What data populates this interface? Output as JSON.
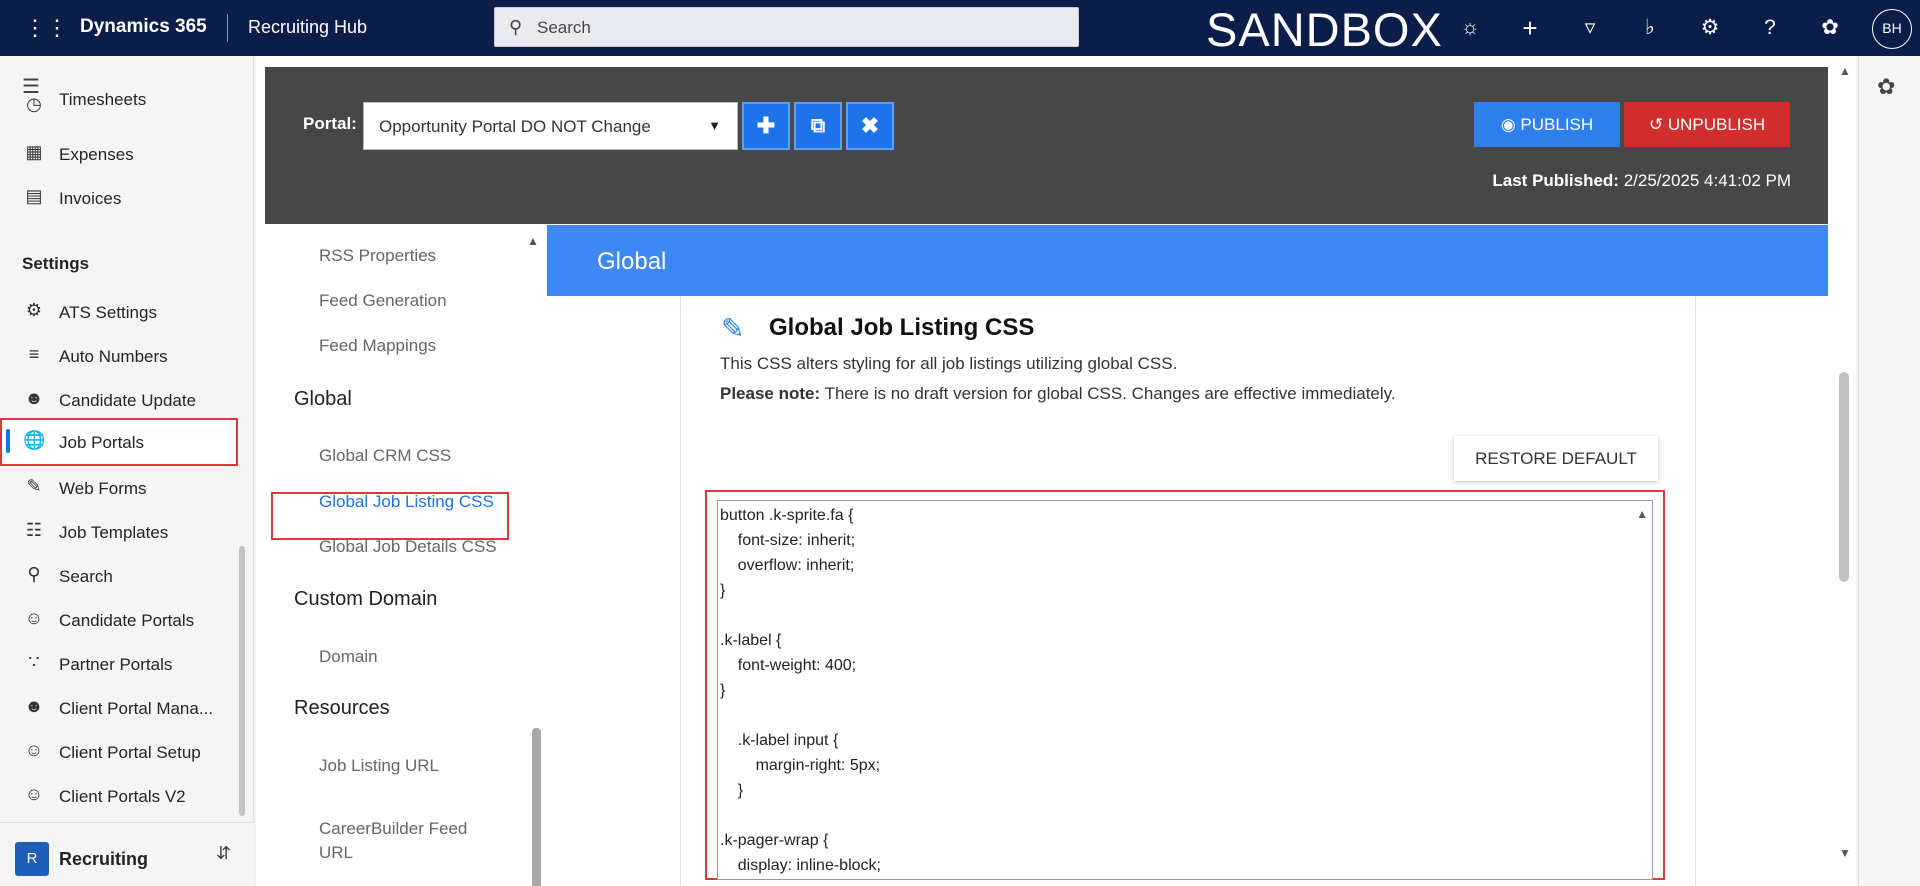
{
  "topbar": {
    "app_name": "Dynamics 365",
    "area_name": "Recruiting Hub",
    "search_placeholder": "Search",
    "env_label": "SANDBOX",
    "avatar_initials": "BH",
    "icons": [
      "lightbulb-icon",
      "plus-icon",
      "filter-icon",
      "bell-icon",
      "gear-icon",
      "help-icon",
      "copilot-icon"
    ]
  },
  "leftnav": {
    "items_top": [
      {
        "label": "Timesheets",
        "icon": "timesheet-icon"
      },
      {
        "label": "Expenses",
        "icon": "expenses-icon"
      },
      {
        "label": "Invoices",
        "icon": "invoice-icon"
      }
    ],
    "settings_heading": "Settings",
    "settings_items": [
      {
        "label": "ATS Settings",
        "icon": "gear-icon"
      },
      {
        "label": "Auto Numbers",
        "icon": "numbered-list-icon"
      },
      {
        "label": "Candidate Update",
        "icon": "person-sync-icon"
      },
      {
        "label": "Job Portals",
        "icon": "globe-icon",
        "active": true
      },
      {
        "label": "Web Forms",
        "icon": "form-edit-icon"
      },
      {
        "label": "Job Templates",
        "icon": "template-icon"
      },
      {
        "label": "Search",
        "icon": "search-people-icon"
      },
      {
        "label": "Candidate Portals",
        "icon": "people-icon"
      },
      {
        "label": "Partner Portals",
        "icon": "group-icon"
      },
      {
        "label": "Client Portal Mana...",
        "icon": "person-lock-icon"
      },
      {
        "label": "Client Portal Setup",
        "icon": "person-settings-icon"
      },
      {
        "label": "Client Portals V2",
        "icon": "person-icon"
      }
    ],
    "area_switcher": {
      "initial": "R",
      "label": "Recruiting"
    }
  },
  "portal_bar": {
    "label": "Portal:",
    "selected_portal": "Opportunity Portal DO NOT Change",
    "publish_label": "PUBLISH",
    "unpublish_label": "UNPUBLISH",
    "last_published_label": "Last Published:",
    "last_published_value": "2/25/2025 4:41:02 PM"
  },
  "subnav": {
    "items": [
      {
        "type": "item",
        "label": "RSS Properties"
      },
      {
        "type": "item",
        "label": "Feed Generation"
      },
      {
        "type": "item",
        "label": "Feed Mappings"
      },
      {
        "type": "heading",
        "label": "Global"
      },
      {
        "type": "item",
        "label": "Global CRM CSS"
      },
      {
        "type": "item",
        "label": "Global Job Listing CSS",
        "active": true
      },
      {
        "type": "item",
        "label": "Global Job Details CSS"
      },
      {
        "type": "heading",
        "label": "Custom Domain"
      },
      {
        "type": "item",
        "label": "Domain"
      },
      {
        "type": "heading",
        "label": "Resources"
      },
      {
        "type": "item",
        "label": "Job Listing URL"
      },
      {
        "type": "item",
        "label": "CareerBuilder Feed URL"
      }
    ]
  },
  "content": {
    "banner_title": "Global",
    "card_title": "Global Job Listing CSS",
    "description": "This CSS alters styling for all job listings utilizing global CSS.",
    "note_label": "Please note:",
    "note_text": " There is no draft version for global CSS. Changes are effective immediately.",
    "restore_label": "RESTORE DEFAULT",
    "css_lines": [
      "button .k-sprite.fa {",
      "    font-size: inherit;",
      "    overflow: inherit;",
      "}",
      "",
      ".k-label {",
      "    font-weight: 400;",
      "}",
      "",
      "    .k-label input {",
      "        margin-right: 5px;",
      "    }",
      "",
      ".k-pager-wrap {",
      "    display: inline-block;"
    ]
  }
}
